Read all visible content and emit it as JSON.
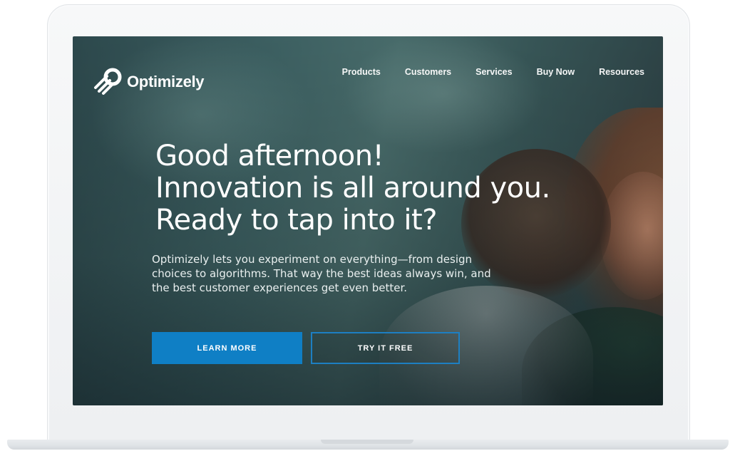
{
  "header": {
    "logo_text": "Optimizely",
    "nav": [
      {
        "label": "Products"
      },
      {
        "label": "Customers"
      },
      {
        "label": "Services"
      },
      {
        "label": "Buy Now"
      },
      {
        "label": "Resources"
      }
    ]
  },
  "hero": {
    "headline_lines": [
      "Good afternoon!",
      "Innovation is all around you.",
      "Ready to tap into it?"
    ],
    "subtext_lines": [
      "Optimizely lets you experiment on everything—from design",
      "choices to algorithms. That way the best ideas always win, and",
      "the best customer experiences get even better."
    ],
    "primary_button": "LEARN MORE",
    "secondary_button": "TRY IT FREE"
  },
  "colors": {
    "primary_button": "#0f7fc5",
    "outline_button_border": "#1d7fc2",
    "text": "#ffffff",
    "laptop_frame": "#f2f4f6"
  },
  "icons": {
    "logo": "optimizely-logo-icon"
  }
}
